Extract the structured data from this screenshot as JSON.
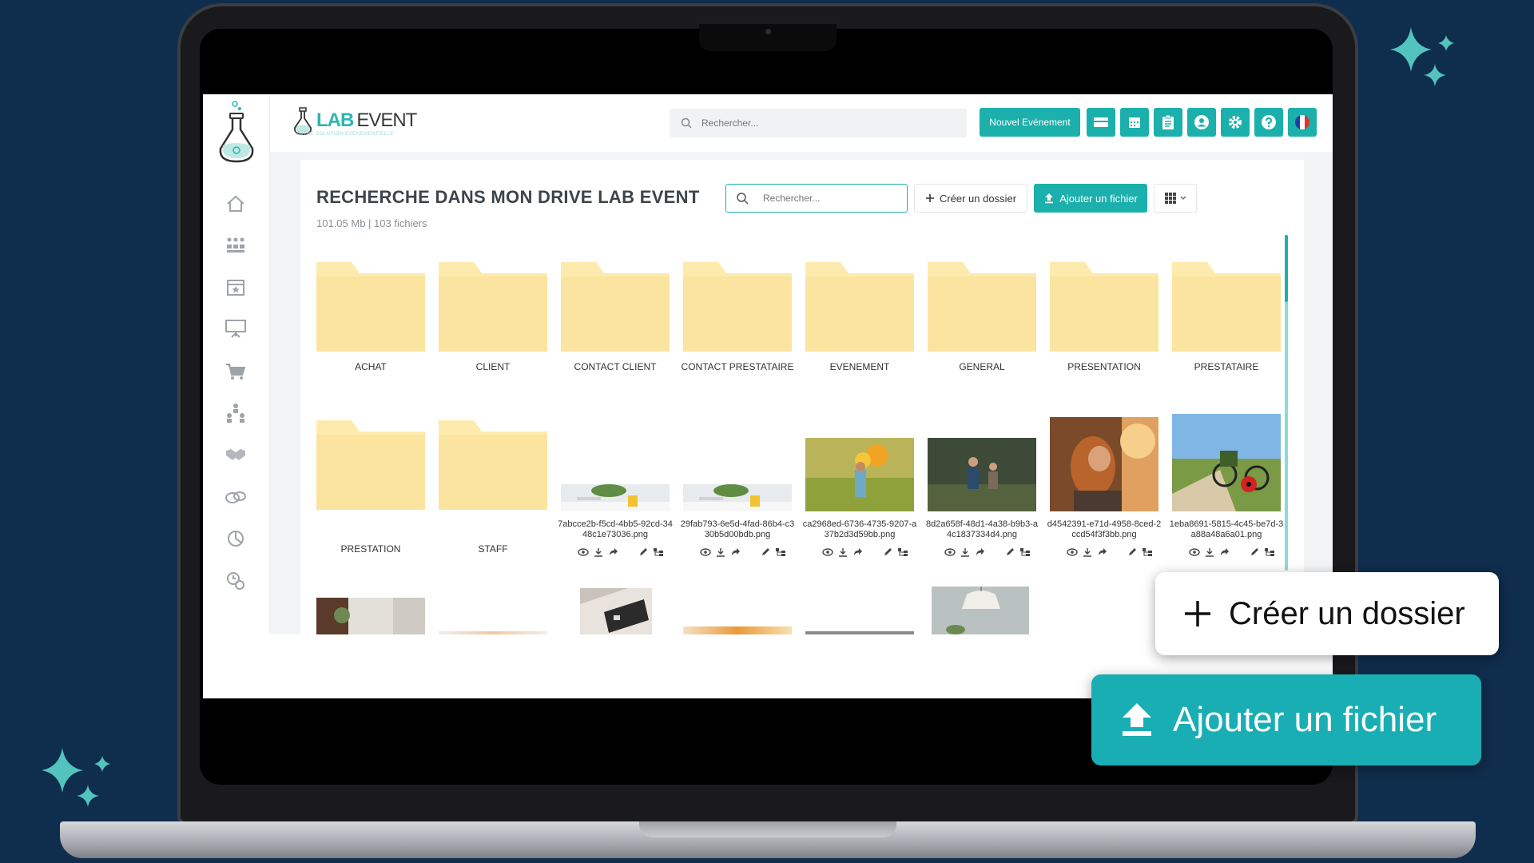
{
  "brand": {
    "lab": "LAB",
    "event": "EVENT",
    "tagline": "VOTRE SOLUTION EVENEMENTIELLE"
  },
  "topbar": {
    "search_placeholder": "Rechercher...",
    "new_event_label": "Nouvel Evénement",
    "icons": [
      "card-icon",
      "calendar-icon",
      "clipboard-icon",
      "user-icon",
      "gear-icon",
      "help-icon",
      "flag-fr-icon"
    ]
  },
  "sidebar": {
    "items": [
      "home-icon",
      "people-icon",
      "calendar-star-icon",
      "presentation-icon",
      "cart-icon",
      "hierarchy-icon",
      "handshake-icon",
      "coins-icon",
      "pie-chart-icon",
      "settings-clock-icon"
    ]
  },
  "page": {
    "title": "RECHERCHE DANS MON DRIVE LAB EVENT",
    "subtitle": "101.05 Mb | 103 fichiers",
    "search_placeholder": "Rechercher...",
    "create_folder_label": "Créer un dossier",
    "upload_label": "Ajouter un fichier"
  },
  "folders_row1": [
    "ACHAT",
    "CLIENT",
    "CONTACT CLIENT",
    "CONTACT PRESTATAIRE",
    "EVENEMENT",
    "GENERAL",
    "PRESENTATION",
    "PRESTATAIRE"
  ],
  "folders_row2": [
    "PRESTATION",
    "STAFF"
  ],
  "files": [
    "7abcce2b-f5cd-4bb5-92cd-3448c1e73036.png",
    "29fab793-6e5d-4fad-86b4-c330b5d00bdb.png",
    "ca2968ed-6736-4735-9207-a37b2d3d59bb.png",
    "8d2a658f-48d1-4a38-b9b3-a4c1837334d4.png",
    "d4542391-e71d-4958-8ced-2ccd54f3f3bb.png",
    "1eba8691-5815-4c45-be7d-3a88a48a6a01.png"
  ],
  "callouts": {
    "create_folder": "Créer un dossier",
    "upload": "Ajouter un fichier"
  }
}
